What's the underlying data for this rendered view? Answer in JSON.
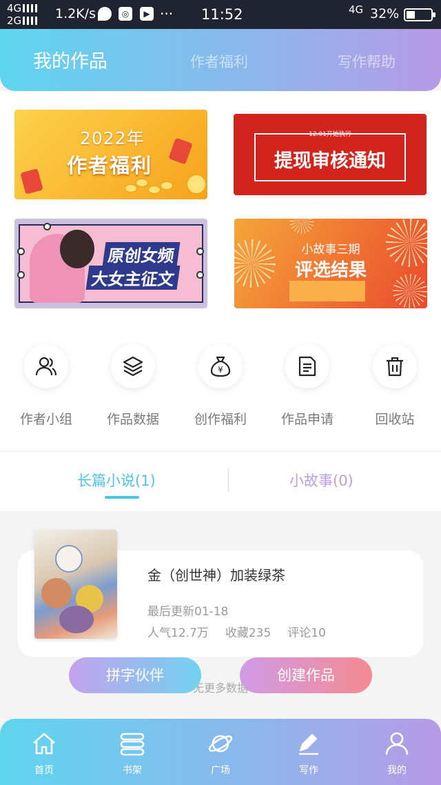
{
  "status_bar": {
    "net1": "4G",
    "net2": "2G",
    "speed": "1.2K/s",
    "more": "···",
    "time": "11:52",
    "net_right": "4G",
    "battery": "32%"
  },
  "header": {
    "tabs": [
      {
        "label": "我的作品"
      },
      {
        "label": "作者福利"
      },
      {
        "label": "写作帮助"
      }
    ]
  },
  "banners": [
    {
      "line1": "2022年",
      "line2": "作者福利"
    },
    {
      "small": "12.01开始执行",
      "title": "提现审核通知"
    },
    {
      "line1": "原创女频",
      "line2": "大女主征文"
    },
    {
      "line1": "小故事三期",
      "line2": "评选结果"
    }
  ],
  "quick_links": [
    {
      "label": "作者小组",
      "icon": "users-icon"
    },
    {
      "label": "作品数据",
      "icon": "layers-icon"
    },
    {
      "label": "创作福利",
      "icon": "money-bag-icon"
    },
    {
      "label": "作品申请",
      "icon": "document-icon"
    },
    {
      "label": "回收站",
      "icon": "trash-icon"
    }
  ],
  "work_tabs": [
    {
      "label": "长篇小说(1)"
    },
    {
      "label": "小故事(0)"
    }
  ],
  "book": {
    "title": "金（创世神）加装绿茶",
    "updated": "最后更新01-18",
    "popularity": "人气12.7万",
    "favorites": "收藏235",
    "comments": "评论10"
  },
  "no_more": "无更多数据",
  "actions": {
    "partner": "拼字伙伴",
    "create": "创建作品"
  },
  "bottom_nav": [
    {
      "label": "首页",
      "icon": "home-icon"
    },
    {
      "label": "书架",
      "icon": "bookshelf-icon"
    },
    {
      "label": "广场",
      "icon": "planet-icon"
    },
    {
      "label": "写作",
      "icon": "pen-icon"
    },
    {
      "label": "我的",
      "icon": "user-icon"
    }
  ],
  "colors": {
    "gradient_start": "#5fd5ee",
    "gradient_end": "#b79ae6",
    "accent": "#4bc4e5"
  }
}
